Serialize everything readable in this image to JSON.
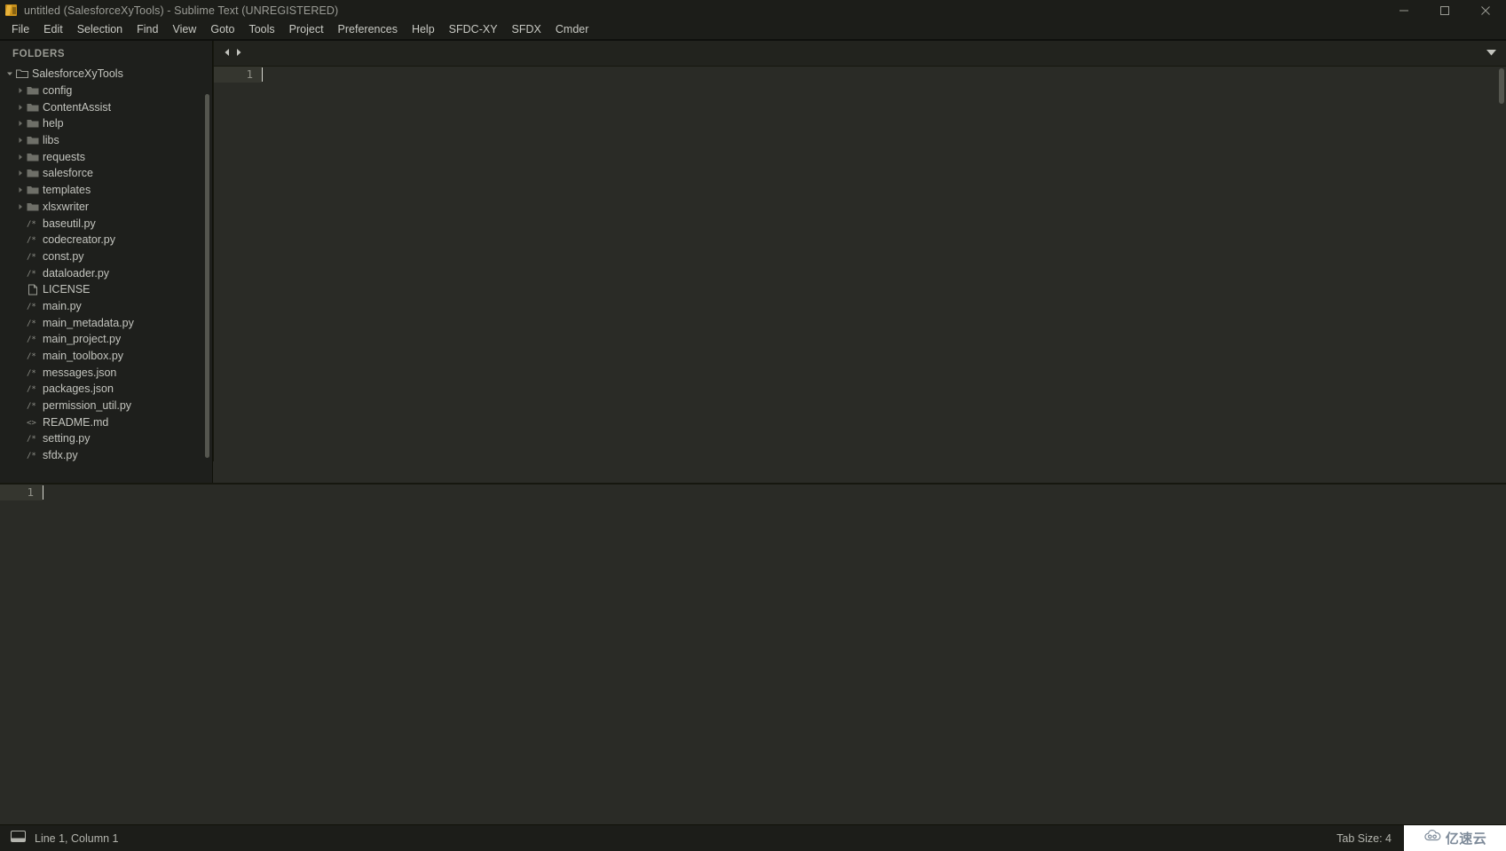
{
  "window": {
    "title": "untitled (SalesforceXyTools) - Sublime Text (UNREGISTERED)",
    "app_icon": "sublime-text-icon",
    "controls": {
      "minimize": "minimize-icon",
      "maximize": "maximize-icon",
      "close": "close-icon"
    }
  },
  "menubar": {
    "items": [
      {
        "label": "File"
      },
      {
        "label": "Edit"
      },
      {
        "label": "Selection"
      },
      {
        "label": "Find"
      },
      {
        "label": "View"
      },
      {
        "label": "Goto"
      },
      {
        "label": "Tools"
      },
      {
        "label": "Project"
      },
      {
        "label": "Preferences"
      },
      {
        "label": "Help"
      },
      {
        "label": "SFDC-XY"
      },
      {
        "label": "SFDX"
      },
      {
        "label": "Cmder"
      }
    ]
  },
  "sidebar": {
    "header": "FOLDERS",
    "root": {
      "label": "SalesforceXyTools",
      "expanded": true,
      "icon": "folder-open-icon"
    },
    "folders": [
      {
        "label": "config",
        "icon": "folder-icon",
        "expanded": false
      },
      {
        "label": "ContentAssist",
        "icon": "folder-icon",
        "expanded": false
      },
      {
        "label": "help",
        "icon": "folder-icon",
        "expanded": false
      },
      {
        "label": "libs",
        "icon": "folder-icon",
        "expanded": false
      },
      {
        "label": "requests",
        "icon": "folder-icon",
        "expanded": false
      },
      {
        "label": "salesforce",
        "icon": "folder-icon",
        "expanded": false
      },
      {
        "label": "templates",
        "icon": "folder-icon",
        "expanded": false
      },
      {
        "label": "xlsxwriter",
        "icon": "folder-icon",
        "expanded": false
      }
    ],
    "files": [
      {
        "label": "baseutil.py",
        "icon": "code-file-icon",
        "glyph": "/*"
      },
      {
        "label": "codecreator.py",
        "icon": "code-file-icon",
        "glyph": "/*"
      },
      {
        "label": "const.py",
        "icon": "code-file-icon",
        "glyph": "/*"
      },
      {
        "label": "dataloader.py",
        "icon": "code-file-icon",
        "glyph": "/*"
      },
      {
        "label": "LICENSE",
        "icon": "plain-file-icon",
        "glyph": ""
      },
      {
        "label": "main.py",
        "icon": "code-file-icon",
        "glyph": "/*"
      },
      {
        "label": "main_metadata.py",
        "icon": "code-file-icon",
        "glyph": "/*"
      },
      {
        "label": "main_project.py",
        "icon": "code-file-icon",
        "glyph": "/*"
      },
      {
        "label": "main_toolbox.py",
        "icon": "code-file-icon",
        "glyph": "/*"
      },
      {
        "label": "messages.json",
        "icon": "code-file-icon",
        "glyph": "/*"
      },
      {
        "label": "packages.json",
        "icon": "code-file-icon",
        "glyph": "/*"
      },
      {
        "label": "permission_util.py",
        "icon": "code-file-icon",
        "glyph": "/*"
      },
      {
        "label": "README.md",
        "icon": "markup-file-icon",
        "glyph": "<>"
      },
      {
        "label": "setting.py",
        "icon": "code-file-icon",
        "glyph": "/*"
      },
      {
        "label": "sfdx.py",
        "icon": "code-file-icon",
        "glyph": "/*"
      }
    ]
  },
  "editor": {
    "tabbar": {
      "prev_icon": "arrow-left-icon",
      "next_icon": "arrow-right-icon",
      "menu_icon": "chevron-down-icon"
    },
    "top_pane": {
      "line_numbers": [
        "1"
      ],
      "content": ""
    },
    "bottom_pane": {
      "line_numbers": [
        "1"
      ],
      "content": ""
    }
  },
  "statusbar": {
    "console_icon": "console-icon",
    "position": "Line 1, Column 1",
    "tab_size": "Tab Size: 4",
    "watermark": {
      "icon": "cloud-icon",
      "text": "亿速云"
    }
  },
  "colors": {
    "titlebar_bg": "#1c1d19",
    "sidebar_bg": "#1e1f1c",
    "editor_bg": "#2a2b26",
    "tabbar_bg": "#22231e",
    "gutter_active": "#35362f",
    "text": "#c3c4be",
    "accent": "#e8b33c"
  }
}
